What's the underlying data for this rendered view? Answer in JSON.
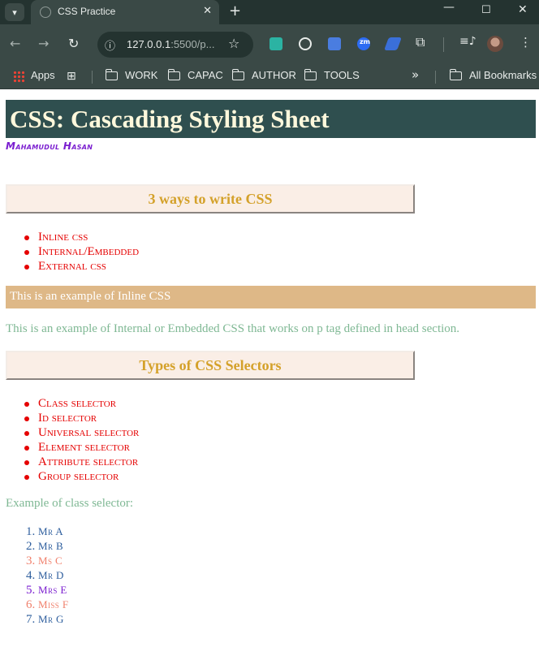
{
  "browser": {
    "tab_title": "CSS Practice",
    "tab_menu_icon": "chevron-down-icon",
    "url_host": "127.0.0.1",
    "url_rest": ":5500/p...",
    "bookmarks": [
      "Apps",
      "WORK",
      "CAPAC",
      "AUTHOR",
      "TOOLS"
    ],
    "all_bookmarks": "All Bookmarks"
  },
  "page": {
    "title": "CSS: Cascading Styling Sheet",
    "author": "Mahamudul Hasan",
    "section1_heading": "3 ways to write CSS",
    "ways": [
      "Inline css",
      "Internal/Embedded",
      "External css"
    ],
    "inline_example": "This is an example of Inline CSS",
    "internal_example": "This is an example of Internal or Embedded CSS that works on p tag defined in head section.",
    "section2_heading": "Types of CSS Selectors",
    "selectors": [
      "Class selector",
      "Id selector",
      "Universal selector",
      "Element selector",
      "Attribute selector",
      "Group selector"
    ],
    "class_example_label": "Example of class selector:",
    "names": [
      {
        "num": "1.",
        "name": "Mr A",
        "color": "#2f5f9e"
      },
      {
        "num": "2.",
        "name": "Mr B",
        "color": "#2f5f9e"
      },
      {
        "num": "3.",
        "name": "Ms C",
        "color": "#f0806c"
      },
      {
        "num": "4.",
        "name": "Mr D",
        "color": "#2f5f9e"
      },
      {
        "num": "5.",
        "name": "Mrs E",
        "color": "#7b1fd0"
      },
      {
        "num": "6.",
        "name": "Miss F",
        "color": "#f0806c"
      },
      {
        "num": "7.",
        "name": "Mr G",
        "color": "#2f5f9e"
      }
    ]
  },
  "colors": {
    "banner_bg": "#2f4f4f",
    "banner_text": "#fff8dc",
    "heading_gold": "#d4a12a",
    "list_red": "#e50000",
    "inline_bg": "#deb887",
    "internal_text": "#7fb894"
  }
}
